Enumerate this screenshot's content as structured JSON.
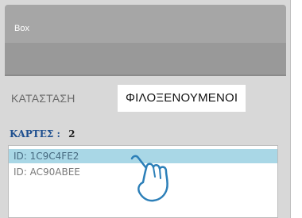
{
  "window": {
    "title": "Box"
  },
  "tabs": [
    {
      "label": "ΚΑΤΑΣΤΑΣΗ",
      "active": false
    },
    {
      "label": "ΦΙΛΟΞΕΝΟΥΜΕΝΟΙ",
      "active": true
    }
  ],
  "cards": {
    "label": "ΚΑΡΤΕΣ :",
    "count": "2",
    "items": [
      {
        "id": "ID: 1C9C4FE2",
        "selected": true
      },
      {
        "id": "ID: AC90ABEE",
        "selected": false
      }
    ]
  },
  "colors": {
    "header": "#a6a6a6",
    "accent": "#1e4f8f",
    "selection": "#a9d7e6"
  },
  "icons": {
    "pointer": "hand-pointer-icon"
  }
}
